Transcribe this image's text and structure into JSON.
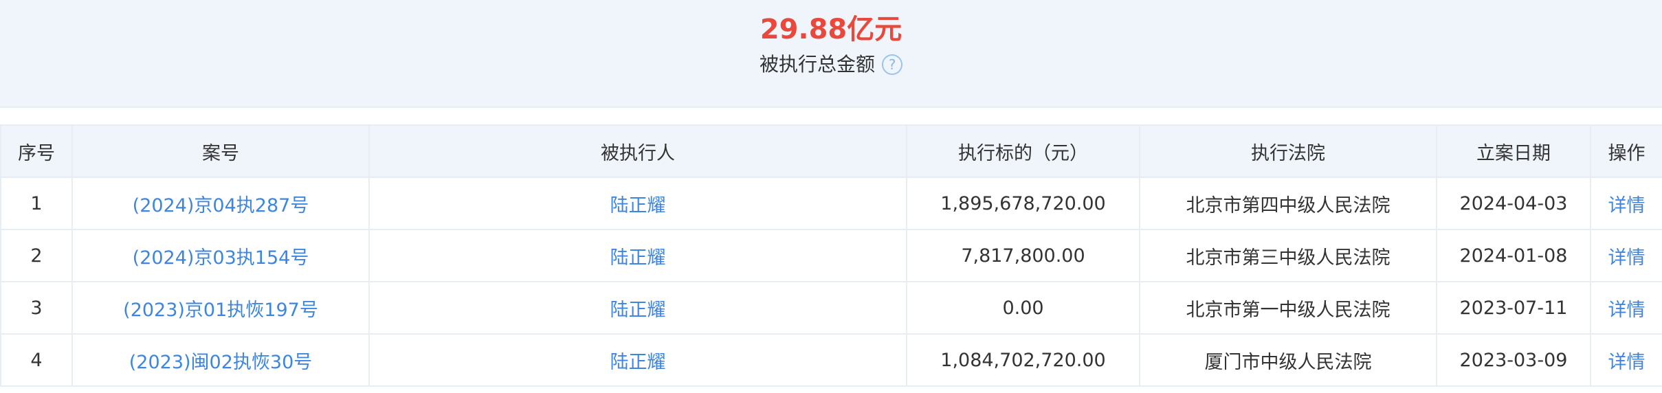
{
  "summary": {
    "total_amount": "29.88亿元",
    "label": "被执行总金额",
    "help_glyph": "?"
  },
  "table": {
    "headers": {
      "index": "序号",
      "case_no": "案号",
      "person": "被执行人",
      "amount": "执行标的（元）",
      "court": "执行法院",
      "date": "立案日期",
      "action": "操作"
    },
    "rows": [
      {
        "index": "1",
        "case_no": "(2024)京04执287号",
        "person": "陆正耀",
        "amount": "1,895,678,720.00",
        "court": "北京市第四中级人民法院",
        "date": "2024-04-03",
        "action": "详情"
      },
      {
        "index": "2",
        "case_no": "(2024)京03执154号",
        "person": "陆正耀",
        "amount": "7,817,800.00",
        "court": "北京市第三中级人民法院",
        "date": "2024-01-08",
        "action": "详情"
      },
      {
        "index": "3",
        "case_no": "(2023)京01执恢197号",
        "person": "陆正耀",
        "amount": "0.00",
        "court": "北京市第一中级人民法院",
        "date": "2023-07-11",
        "action": "详情"
      },
      {
        "index": "4",
        "case_no": "(2023)闽02执恢30号",
        "person": "陆正耀",
        "amount": "1,084,702,720.00",
        "court": "厦门市中级人民法院",
        "date": "2023-03-09",
        "action": "详情"
      }
    ]
  },
  "colors": {
    "amount_red": "#e8493c",
    "link_blue": "#3d86e0",
    "header_bg": "#eff5fb"
  }
}
